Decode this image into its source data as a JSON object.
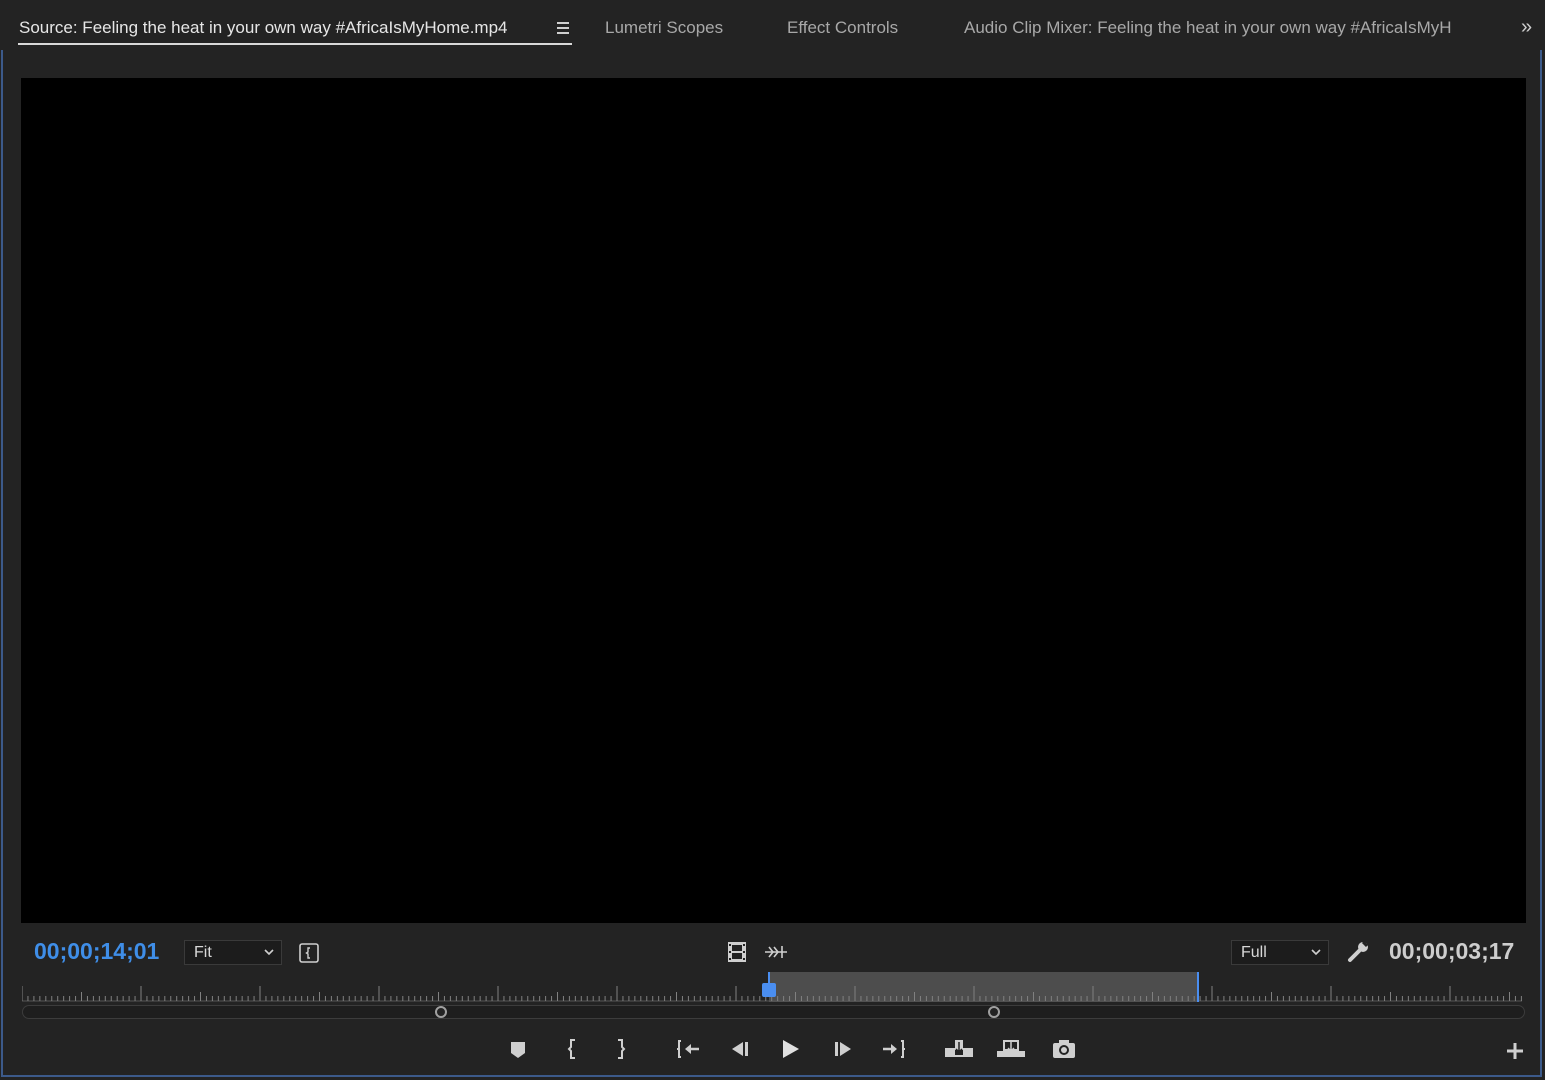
{
  "tabs": [
    {
      "label": "Source: Feeling the heat in your own way  #AfricaIsMyHome.mp4",
      "active": true
    },
    {
      "label": "Lumetri Scopes",
      "active": false
    },
    {
      "label": "Effect Controls",
      "active": false
    },
    {
      "label": "Audio Clip Mixer: Feeling the heat in your own way  #AfricaIsMyH",
      "active": false
    }
  ],
  "controls": {
    "current_timecode": "00;00;14;01",
    "duration_timecode": "00;00;03;17",
    "zoom_value": "Fit",
    "resolution_value": "Full"
  },
  "transport": [
    "add-marker-icon",
    "mark-in-icon",
    "mark-out-icon",
    "go-to-in-icon",
    "step-back-icon",
    "play-icon",
    "step-forward-icon",
    "go-to-out-icon",
    "insert-icon",
    "overwrite-icon",
    "export-frame-icon"
  ],
  "colors": {
    "accent": "#3f8ee8",
    "panel": "#232323",
    "video": "#000000"
  }
}
